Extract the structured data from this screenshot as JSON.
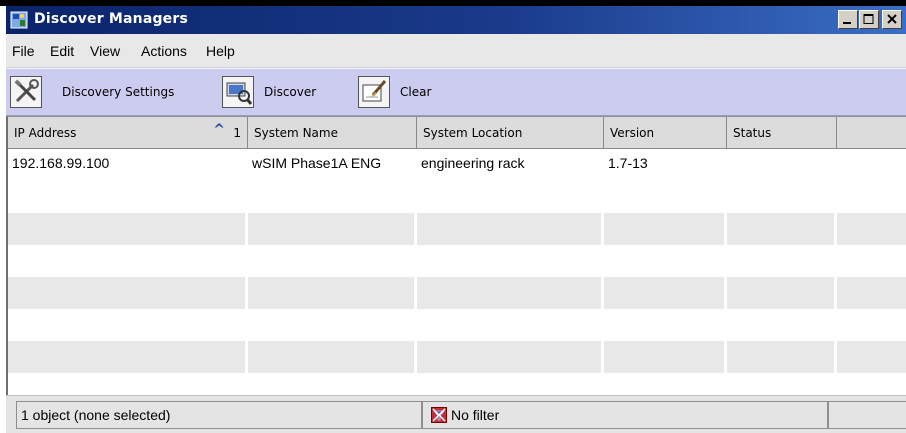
{
  "window": {
    "title": "Discover Managers",
    "controls": [
      "minimize",
      "maximize",
      "close"
    ]
  },
  "menu": {
    "items": [
      "File",
      "Edit",
      "View",
      "Actions",
      "Help"
    ]
  },
  "toolbar": {
    "settings_label": "Discovery Settings",
    "discover_label": "Discover",
    "clear_label": "Clear"
  },
  "table": {
    "columns": [
      "IP Address",
      "System Name",
      "System Location",
      "Version",
      "Status",
      ""
    ],
    "sort": {
      "column": "IP Address",
      "indicator": "^",
      "order": "1"
    },
    "rows": [
      [
        "192.168.99.100",
        "wSIM Phase1A ENG",
        "engineering rack",
        "1.7-13",
        "",
        ""
      ]
    ],
    "empty_rows": 7
  },
  "status": {
    "objects": "1 object (none selected)",
    "filter": "No filter"
  },
  "colors": {
    "titlebar": "#0a246a",
    "toolbar": "#ccccf0",
    "row_alt": "#e8e8e8"
  }
}
